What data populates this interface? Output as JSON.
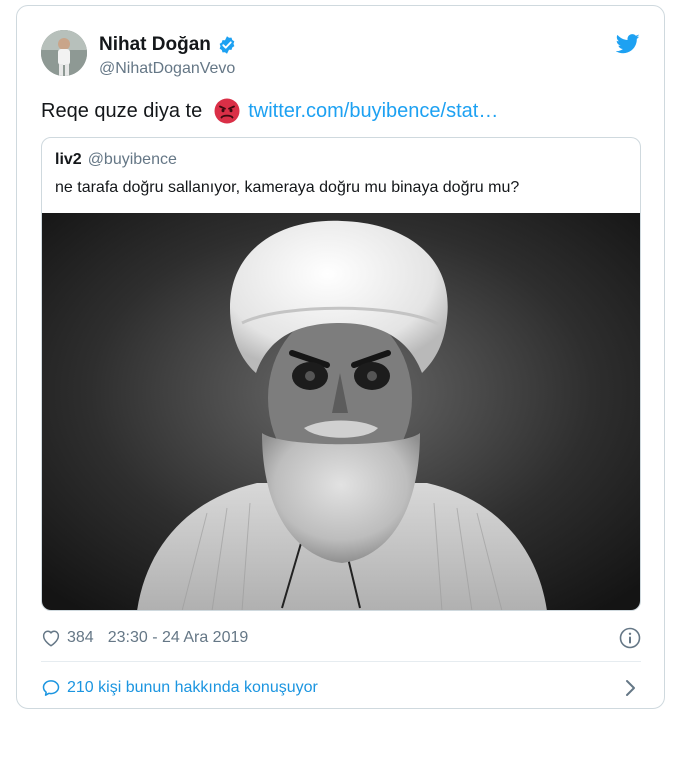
{
  "author": {
    "display_name": "Nihat Doğan",
    "handle": "@NihatDoganVevo",
    "verified": true,
    "avatar_icon": "person-photo-avatar"
  },
  "tweet": {
    "text": "Reqe quze diya te",
    "emoji_icon": "angry-face-emoji",
    "link_text": "twitter.com/buyibence/stat…"
  },
  "quoted_tweet": {
    "name": "liv2",
    "handle": "@buyibence",
    "text": "ne tarafa doğru sallanıyor, kameraya doğru mu binaya doğru mu?",
    "image_icon": "black-and-white-portrait-photo"
  },
  "meta": {
    "like_count": "384",
    "timestamp": "23:30 - 24 Ara 2019"
  },
  "conversation": {
    "label": "210 kişi bunun hakkında konuşuyor"
  },
  "colors": {
    "link": "#1da1f2",
    "verified": "#1da1f2",
    "secondary_text": "#657786",
    "border": "#cfd9de"
  }
}
